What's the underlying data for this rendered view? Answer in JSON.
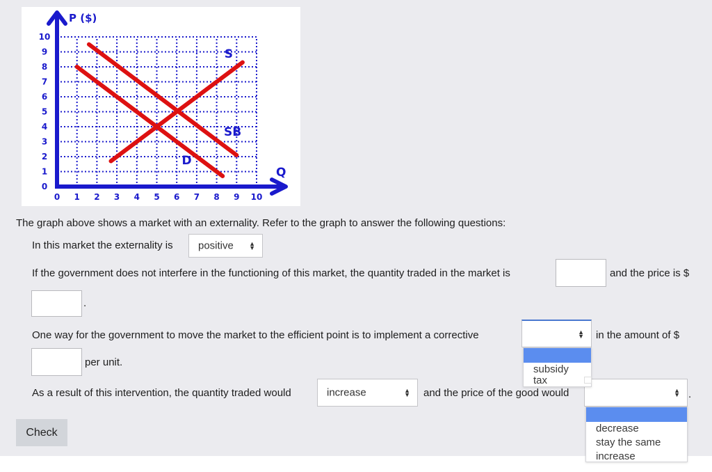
{
  "graph": {
    "y_axis_label": "P ($)",
    "x_axis_label": "Q",
    "axis_color": "#1a1acc",
    "curve_color": "#dd1111",
    "chart_data": {
      "type": "line",
      "title": "",
      "xlabel": "Q",
      "ylabel": "P ($)",
      "xlim": [
        0,
        10
      ],
      "ylim": [
        0,
        10
      ],
      "x_ticks": [
        "0",
        "1",
        "2",
        "3",
        "4",
        "5",
        "6",
        "7",
        "8",
        "9",
        "10"
      ],
      "y_ticks": [
        "0",
        "1",
        "2",
        "3",
        "4",
        "5",
        "6",
        "7",
        "8",
        "9",
        "10"
      ],
      "grid": true,
      "series": [
        {
          "name": "S",
          "points": [
            [
              2.7,
              1.7
            ],
            [
              9.3,
              8.3
            ]
          ]
        },
        {
          "name": "D",
          "points": [
            [
              1.0,
              8.0
            ],
            [
              8.3,
              0.7
            ]
          ]
        },
        {
          "name": "SB",
          "points": [
            [
              1.6,
              9.5
            ],
            [
              9.0,
              2.1
            ]
          ]
        }
      ],
      "annotations": [
        {
          "text": "S",
          "x": 8.6,
          "y": 8.6
        },
        {
          "text": "SB",
          "x": 8.8,
          "y": 3.4
        },
        {
          "text": "D",
          "x": 6.5,
          "y": 1.5
        }
      ]
    }
  },
  "question": {
    "intro": "The graph above shows a market with an externality. Refer to the graph to answer the following questions:",
    "q1_text": "In this market the externality is",
    "q1_select_value": "positive",
    "q2_text_a": "If the government does not interfere in the functioning of this market, the quantity traded in the market is",
    "q2_text_b": "and the price is $",
    "q2_quantity_value": "",
    "q2_price_value": "",
    "q2_period": ".",
    "q3_text_a": "One way for the government to move the market to the efficient point is to implement a corrective",
    "q3_select_value": "",
    "q3_text_b": "in the amount of $",
    "q3_amount_value": "",
    "q3_text_c": "per unit.",
    "q3_options": [
      "",
      "subsidy",
      "tax"
    ],
    "q4_text_a": "As a result of this intervention, the quantity traded would",
    "q4_qty_select_value": "increase",
    "q4_text_b": "and the price of the good would",
    "q4_price_select_value": "",
    "q4_period": ".",
    "q4_price_options": [
      "",
      "decrease",
      "stay the same",
      "increase"
    ]
  },
  "check_button": "Check"
}
